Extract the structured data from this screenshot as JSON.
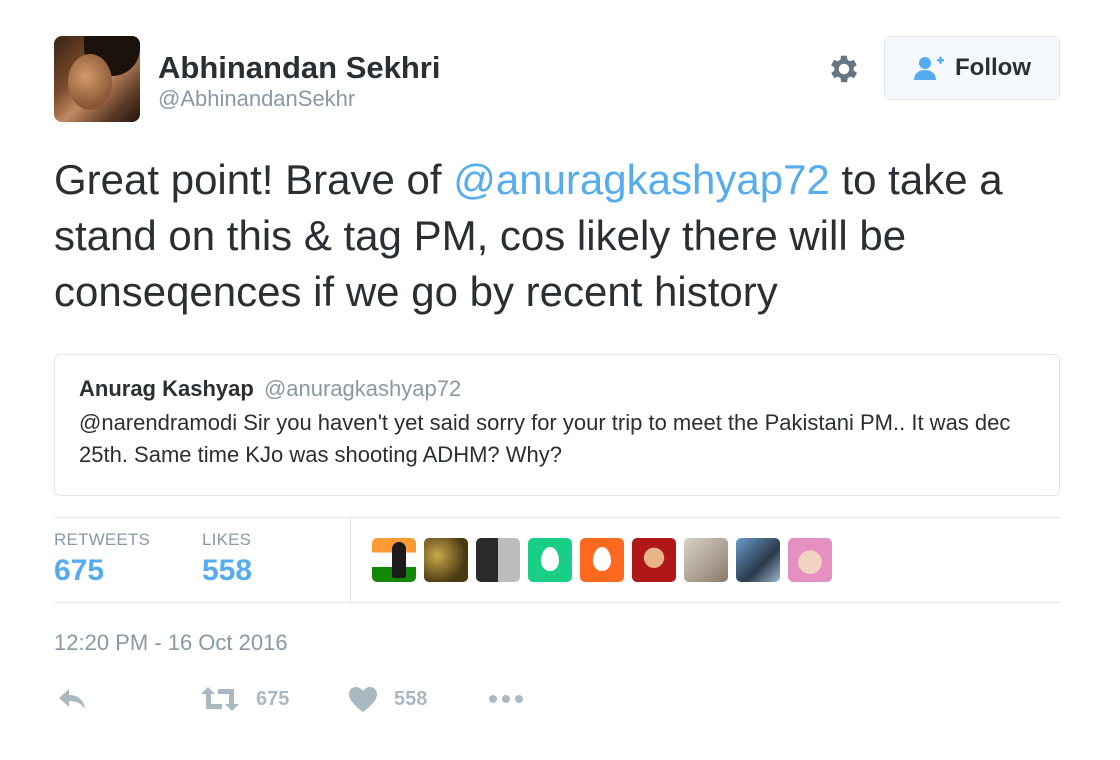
{
  "author": {
    "name": "Abhinandan Sekhri",
    "handle": "@AbhinandanSekhr"
  },
  "header": {
    "follow_label": "Follow"
  },
  "tweet": {
    "text_before": "Great point! Brave of ",
    "mention": "@anuragkashyap72",
    "text_after": " to take a stand on this & tag PM, cos likely there will be conseqences if we go by recent history"
  },
  "quoted": {
    "name": "Anurag Kashyap",
    "handle": "@anuragkashyap72",
    "mention": "@narendramodi",
    "text": " Sir you haven't yet said sorry for your trip to meet the Pakistani PM.. It was dec 25th. Same time KJo was shooting ADHM? Why?"
  },
  "stats": {
    "retweets_label": "RETWEETS",
    "retweets": "675",
    "likes_label": "LIKES",
    "likes": "558"
  },
  "timestamp": "12:20 PM - 16 Oct 2016",
  "actions": {
    "retweet_count": "675",
    "like_count": "558"
  },
  "colors": {
    "link": "#55acee",
    "muted": "#8899a6",
    "text": "#292f33",
    "border": "#e1e8ed",
    "action": "#aab8c2"
  },
  "icons": [
    "gear-icon",
    "follow-person-plus-icon",
    "reply-icon",
    "retweet-icon",
    "heart-icon",
    "more-dots-icon"
  ]
}
